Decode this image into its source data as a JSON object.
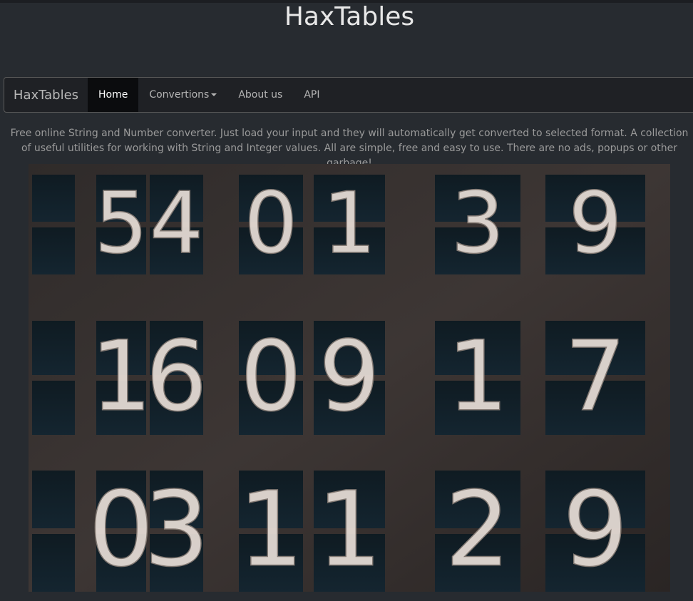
{
  "site": {
    "title": "HaxTables"
  },
  "navbar": {
    "brand": "HaxTables",
    "items": [
      {
        "label": "Home",
        "active": true
      },
      {
        "label": "Convertions",
        "dropdown": true
      },
      {
        "label": "About us"
      },
      {
        "label": "API"
      }
    ]
  },
  "intro": {
    "text": "Free online String and Number converter. Just load your input and they will automatically get converted to selected format. A collection of useful utilities for working with String and Integer values. All are simple, free and easy to use. There are no ads, popups or other garbage!"
  },
  "hero": {
    "image": "split-flap number board photo",
    "digits": [
      "5",
      "4",
      "0",
      "1",
      "3",
      "9",
      "1",
      "6",
      "0",
      "9",
      "1",
      "7",
      "0",
      "3",
      "1",
      "1",
      "2",
      "9"
    ]
  },
  "colors": {
    "background": "#272b30",
    "navbar": "#1f2125",
    "active": "#0b0c0e",
    "accent_text": "#e8e8e8",
    "muted_text": "#9a9a9a"
  }
}
